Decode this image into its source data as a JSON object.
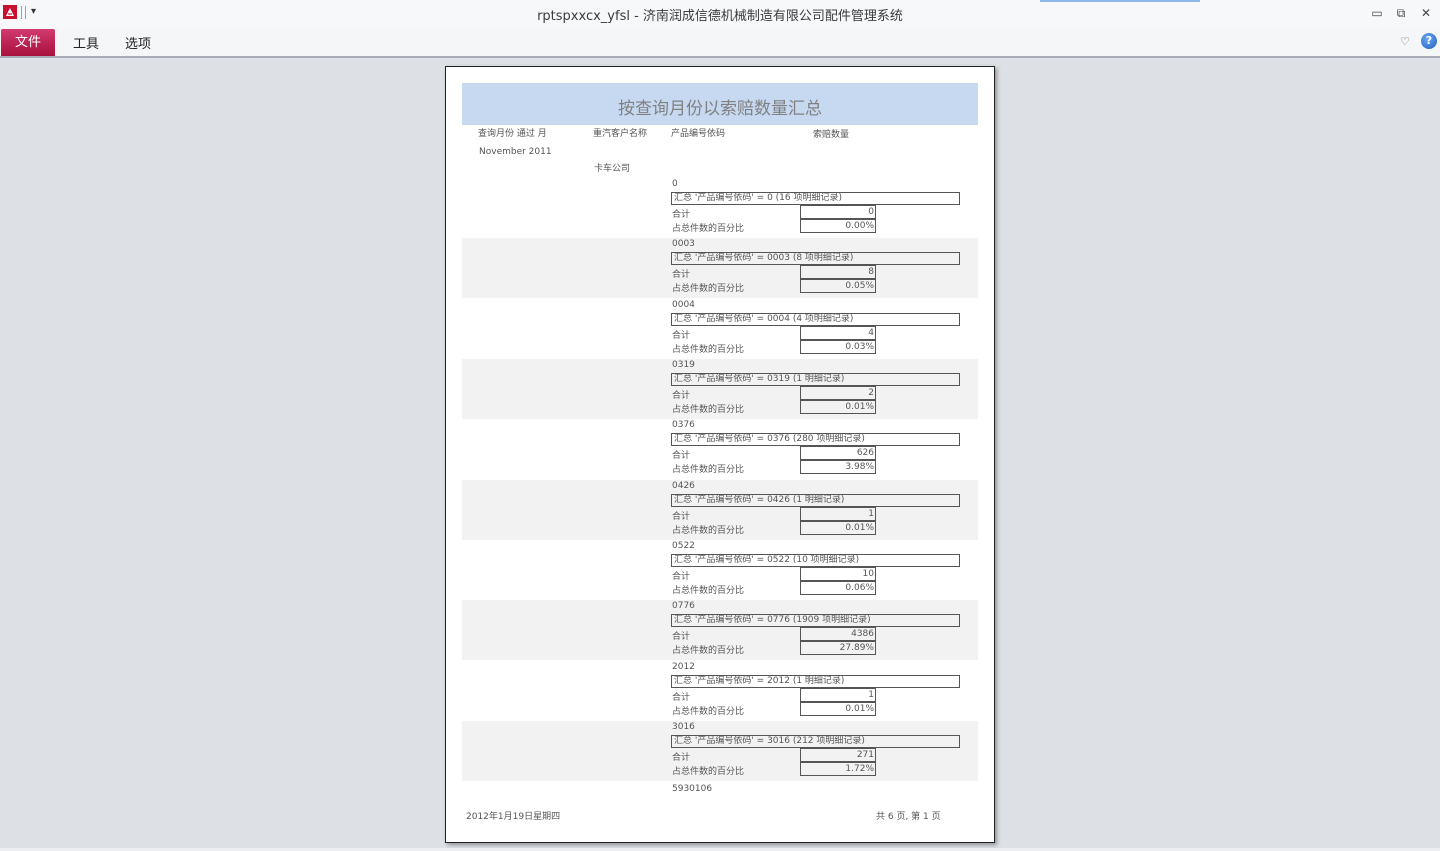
{
  "window": {
    "title": "rptspxxcx_yfsl - 济南润成信德机械制造有限公司配件管理系统",
    "qat_dropdown": "▾",
    "minimize": "▭",
    "restore": "⧉",
    "close": "✕"
  },
  "ribbon": {
    "tabs": [
      {
        "label": "文件"
      },
      {
        "label": "工具"
      },
      {
        "label": "选项"
      }
    ],
    "minimize_ribbon": "♡",
    "help": "?",
    "accent_color": "#b9164f"
  },
  "report": {
    "title": "按查询月份以索赔数量汇总",
    "headers": {
      "month": "查询月份 通过 月",
      "customer": "重汽客户名称",
      "product": "产品编号依码",
      "qty": "索赔数量"
    },
    "month_value": "November 2011",
    "customer_value": "卡车公司",
    "total_label": "合计",
    "pct_label": "占总件数的百分比",
    "groups": [
      {
        "code": "0",
        "summary": "汇总 '产品编号依码' =  0 (16 项明细记录)",
        "total": "0",
        "pct": "0.00%"
      },
      {
        "code": "0003",
        "summary": "汇总 '产品编号依码' =  0003 (8 项明细记录)",
        "total": "8",
        "pct": "0.05%"
      },
      {
        "code": "0004",
        "summary": "汇总 '产品编号依码' =  0004 (4 项明细记录)",
        "total": "4",
        "pct": "0.03%"
      },
      {
        "code": "0319",
        "summary": "汇总 '产品编号依码' =  0319 (1 明细记录)",
        "total": "2",
        "pct": "0.01%"
      },
      {
        "code": "0376",
        "summary": "汇总 '产品编号依码' =  0376 (280 项明细记录)",
        "total": "626",
        "pct": "3.98%"
      },
      {
        "code": "0426",
        "summary": "汇总 '产品编号依码' =  0426 (1 明细记录)",
        "total": "1",
        "pct": "0.01%"
      },
      {
        "code": "0522",
        "summary": "汇总 '产品编号依码' =  0522 (10 项明细记录)",
        "total": "10",
        "pct": "0.06%"
      },
      {
        "code": "0776",
        "summary": "汇总 '产品编号依码' =  0776 (1909 项明细记录)",
        "total": "4386",
        "pct": "27.89%"
      },
      {
        "code": "2012",
        "summary": "汇总 '产品编号依码' =  2012 (1 明细记录)",
        "total": "1",
        "pct": "0.01%"
      },
      {
        "code": "3016",
        "summary": "汇总 '产品编号依码' =  3016 (212 项明细记录)",
        "total": "271",
        "pct": "1.72%"
      }
    ],
    "next_code": "5930106",
    "footer_date": "2012年1月19日星期四",
    "footer_pages": "共 6 页, 第 1 页"
  }
}
